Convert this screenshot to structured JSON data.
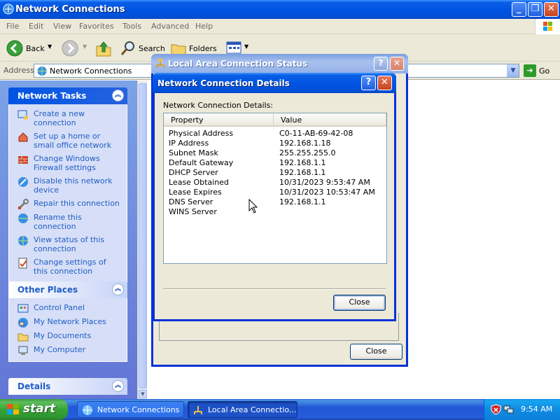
{
  "main_window": {
    "title": "Network Connections",
    "menu": [
      "File",
      "Edit",
      "View",
      "Favorites",
      "Tools",
      "Advanced",
      "Help"
    ],
    "toolbar": {
      "back": "Back",
      "search": "Search",
      "folders": "Folders"
    },
    "address": {
      "label": "Address",
      "value": "Network Connections",
      "go": "Go"
    }
  },
  "task_pane": {
    "network_tasks": {
      "title": "Network Tasks",
      "items": [
        "Create a new connection",
        "Set up a home or small office network",
        "Change Windows Firewall settings",
        "Disable this network device",
        "Repair this connection",
        "Rename this connection",
        "View status of this connection",
        "Change settings of this connection"
      ]
    },
    "other_places": {
      "title": "Other Places",
      "items": [
        "Control Panel",
        "My Network Places",
        "My Documents",
        "My Computer"
      ]
    },
    "details": {
      "title": "Details"
    }
  },
  "status_dialog": {
    "title": "Local Area Connection Status",
    "close_label": "Close"
  },
  "details_dialog": {
    "title": "Network Connection Details",
    "label": "Network Connection Details:",
    "columns": [
      "Property",
      "Value"
    ],
    "rows": [
      {
        "property": "Physical Address",
        "value": "C0-11-AB-69-42-08"
      },
      {
        "property": "IP Address",
        "value": "192.168.1.18"
      },
      {
        "property": "Subnet Mask",
        "value": "255.255.255.0"
      },
      {
        "property": "Default Gateway",
        "value": "192.168.1.1"
      },
      {
        "property": "DHCP Server",
        "value": "192.168.1.1"
      },
      {
        "property": "Lease Obtained",
        "value": "10/31/2023 9:53:47 AM"
      },
      {
        "property": "Lease Expires",
        "value": "10/31/2023 10:53:47 AM"
      },
      {
        "property": "DNS Server",
        "value": "192.168.1.1"
      },
      {
        "property": "WINS Server",
        "value": ""
      }
    ],
    "close_label": "Close"
  },
  "taskbar": {
    "start": "start",
    "tasks": [
      "Network Connections",
      "Local Area Connectio..."
    ],
    "clock": "9:54 AM"
  }
}
